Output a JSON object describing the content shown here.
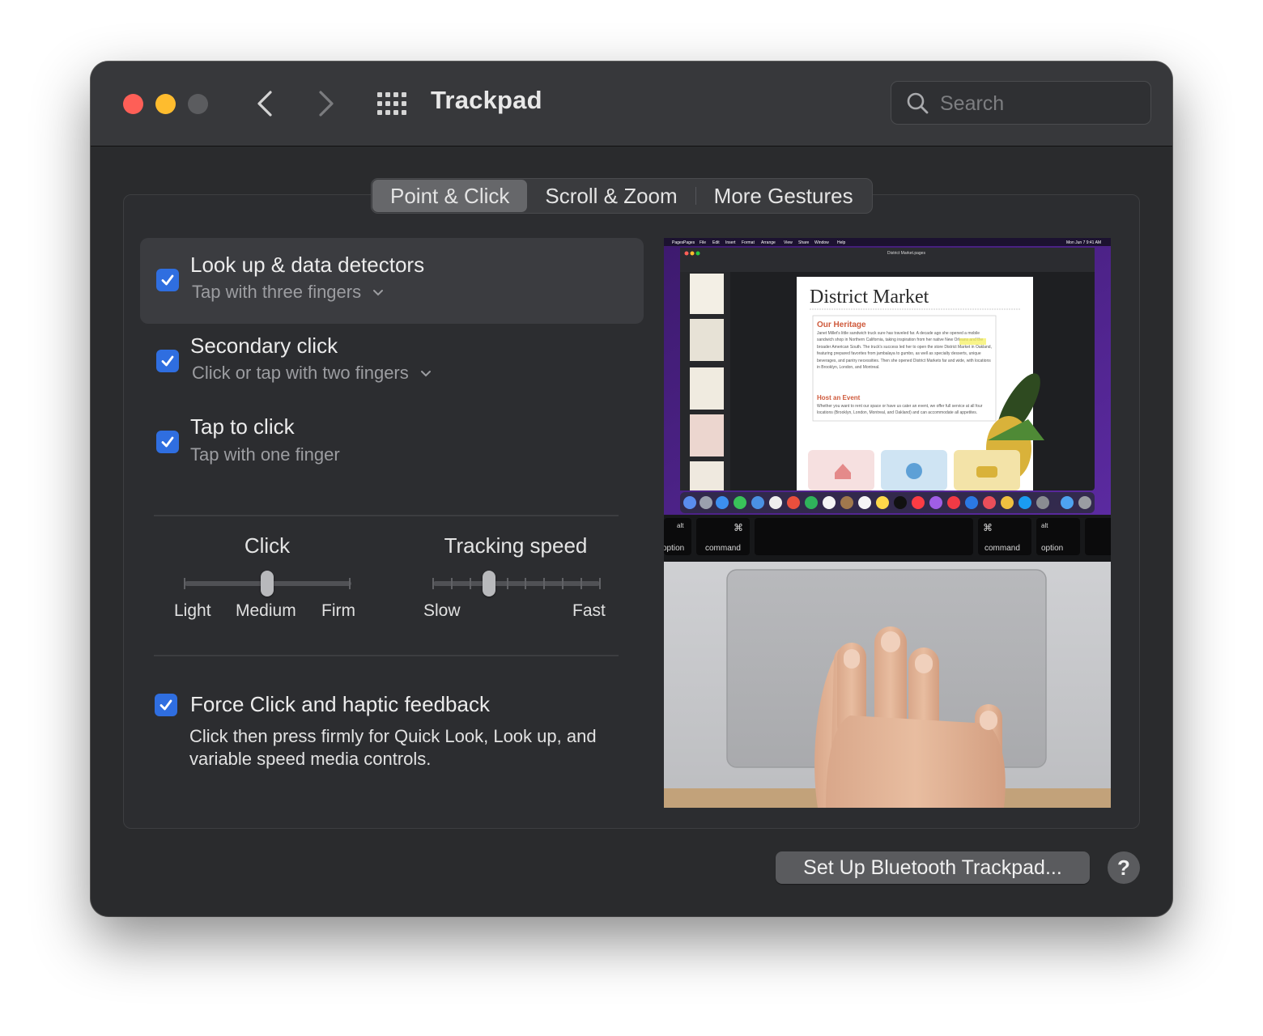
{
  "window": {
    "title": "Trackpad"
  },
  "search": {
    "placeholder": "Search"
  },
  "tabs": [
    {
      "label": "Point & Click",
      "active": true
    },
    {
      "label": "Scroll & Zoom",
      "active": false
    },
    {
      "label": "More Gestures",
      "active": false
    }
  ],
  "options": {
    "lookup": {
      "title": "Look up & data detectors",
      "subtitle": "Tap with three fingers",
      "checked": true
    },
    "secondary": {
      "title": "Secondary click",
      "subtitle": "Click or tap with two fingers",
      "checked": true
    },
    "tap": {
      "title": "Tap to click",
      "subtitle": "Tap with one finger",
      "checked": true
    },
    "force": {
      "title": "Force Click and haptic feedback",
      "description": "Click then press firmly for Quick Look, Look up, and variable speed media controls.",
      "checked": true
    }
  },
  "sliders": {
    "click": {
      "title": "Click",
      "labels": [
        "Light",
        "Medium",
        "Firm"
      ],
      "value": "Medium"
    },
    "tracking": {
      "title": "Tracking speed",
      "min_label": "Slow",
      "max_label": "Fast",
      "value_fraction": 0.333
    }
  },
  "preview": {
    "menu_items": [
      "Pages",
      "File",
      "Edit",
      "Insert",
      "Format",
      "Arrange",
      "View",
      "Share",
      "Window",
      "Help"
    ],
    "menu_time": "Mon Jun 7 9:41 AM",
    "doc_name": "District Market.pages",
    "doc_heading": "District Market",
    "doc_section1": "Our Heritage",
    "doc_body1": "Janet Millet's little sandwich truck sure has traveled far. A decade ago she opened a mobile sandwich shop in Northern California, taking inspiration from her native New Orleans and the broader American South. The truck's success led her to open the store District Market in Oakland, featuring prepared favorites from jambalaya to gumbo, as well as specialty desserts, unique beverages, and pantry necessities. Then she opened District Markets far and wide, with locations in Brooklyn, London, and Montreal.",
    "doc_section2": "Host an Event",
    "doc_body2": "Whether you want to rent our space or have us cater an event, we offer full service at all four locations (Brooklyn, London, Montreal, and Oakland) and can accommodate all appetites.",
    "keys": {
      "option_left": "option",
      "alt_left": "alt",
      "command_left": "command",
      "cmd_symbol": "⌘",
      "command_right": "command",
      "alt_right": "alt",
      "option_right": "option"
    }
  },
  "buttons": {
    "setup_bluetooth": "Set Up Bluetooth Trackpad...",
    "help": "?"
  },
  "colors": {
    "accent": "#2f6ee0",
    "window_bg": "#2a2b2d",
    "titlebar_bg": "#37383b"
  }
}
